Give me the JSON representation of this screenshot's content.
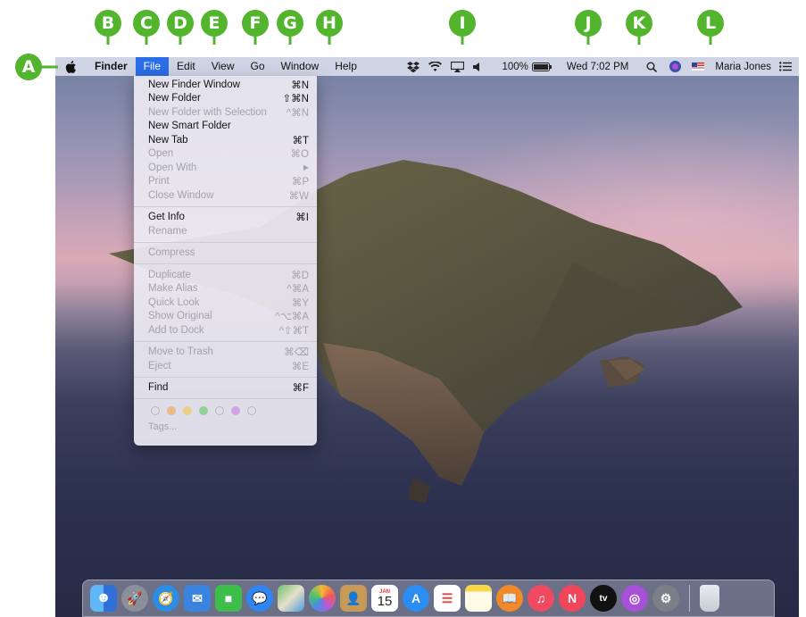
{
  "callouts": [
    "A",
    "B",
    "C",
    "D",
    "E",
    "F",
    "G",
    "H",
    "I",
    "J",
    "K",
    "L"
  ],
  "menubar": {
    "items": [
      "Finder",
      "File",
      "Edit",
      "View",
      "Go",
      "Window",
      "Help"
    ],
    "active": "File"
  },
  "status": {
    "battery": "100%",
    "clock": "Wed 7:02 PM",
    "user": "Maria Jones"
  },
  "file_menu": {
    "items": [
      {
        "label": "New Finder Window",
        "shortcut": "⌘N",
        "enabled": true
      },
      {
        "label": "New Folder",
        "shortcut": "⇧⌘N",
        "enabled": true
      },
      {
        "label": "New Folder with Selection",
        "shortcut": "^⌘N",
        "enabled": false
      },
      {
        "label": "New Smart Folder",
        "shortcut": "",
        "enabled": true
      },
      {
        "label": "New Tab",
        "shortcut": "⌘T",
        "enabled": true
      },
      {
        "label": "Open",
        "shortcut": "⌘O",
        "enabled": false
      },
      {
        "label": "Open With",
        "shortcut": "▶",
        "enabled": false
      },
      {
        "label": "Print",
        "shortcut": "⌘P",
        "enabled": false
      },
      {
        "label": "Close Window",
        "shortcut": "⌘W",
        "enabled": false
      },
      {
        "label": "Get Info",
        "shortcut": "⌘I",
        "enabled": true
      },
      {
        "label": "Rename",
        "shortcut": "",
        "enabled": false
      },
      {
        "label": "Compress",
        "shortcut": "",
        "enabled": false
      },
      {
        "label": "Duplicate",
        "shortcut": "⌘D",
        "enabled": false
      },
      {
        "label": "Make Alias",
        "shortcut": "^⌘A",
        "enabled": false
      },
      {
        "label": "Quick Look",
        "shortcut": "⌘Y",
        "enabled": false
      },
      {
        "label": "Show Original",
        "shortcut": "^⌥⌘A",
        "enabled": false
      },
      {
        "label": "Add to Dock",
        "shortcut": "^⇧⌘T",
        "enabled": false
      },
      {
        "label": "Move to Trash",
        "shortcut": "⌘⌫",
        "enabled": false
      },
      {
        "label": "Eject",
        "shortcut": "⌘E",
        "enabled": false
      },
      {
        "label": "Find",
        "shortcut": "⌘F",
        "enabled": true
      }
    ],
    "tag_colors": [
      "#ffffff00",
      "#f0a03a",
      "#f2c233",
      "#54c257",
      "#ffffff00",
      "#c774e6",
      "#ffffff00"
    ],
    "tags_label": "Tags..."
  },
  "dock": {
    "calendar_month": "JAN",
    "calendar_day": "15",
    "tv_label": "tv",
    "icons": [
      "finder-icon",
      "launchpad-icon",
      "safari-icon",
      "mail-icon",
      "facetime-icon",
      "messages-icon",
      "maps-icon",
      "photos-icon",
      "contacts-icon",
      "calendar-icon",
      "app-store-icon",
      "reminders-icon",
      "notes-icon",
      "books-icon",
      "music-icon",
      "news-icon",
      "tv-icon",
      "podcasts-icon",
      "system-preferences-icon",
      "trash-icon"
    ]
  },
  "colors": {
    "callout": "#52b52d",
    "menu_highlight": "#2b6ee8"
  }
}
